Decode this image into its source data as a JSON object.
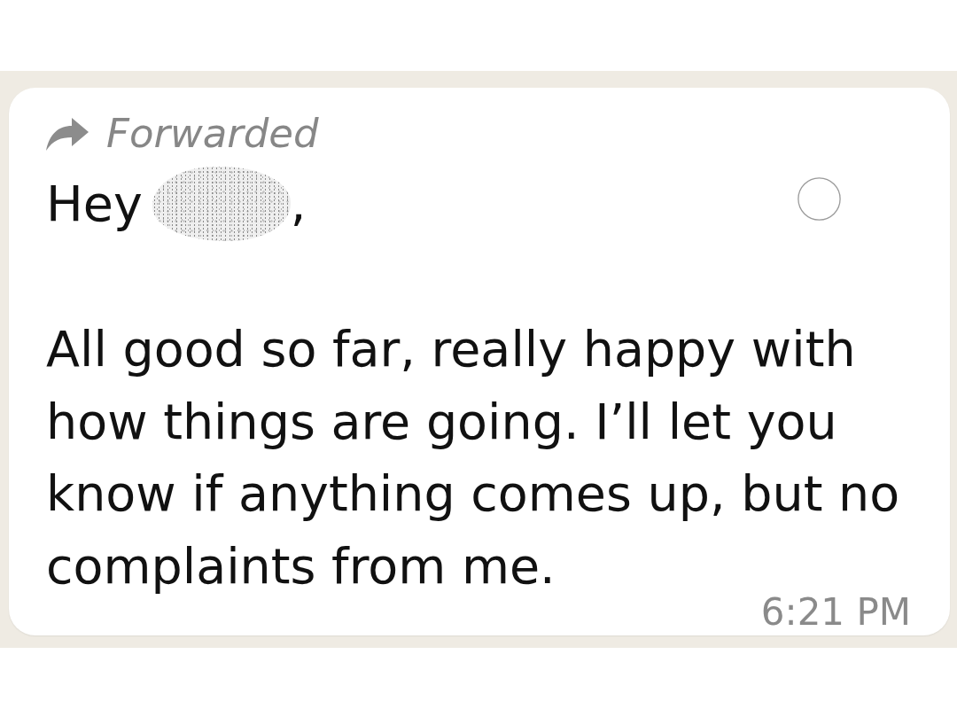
{
  "message": {
    "forwarded": true,
    "forwarded_label": "Forwarded",
    "greeting": "Hey",
    "greeting_end": ",",
    "body": "All good so far, really happy with how things are going. I’ll let you know if anything comes up, but no complaints from me.",
    "time": "6:21 PM",
    "selected": false
  }
}
